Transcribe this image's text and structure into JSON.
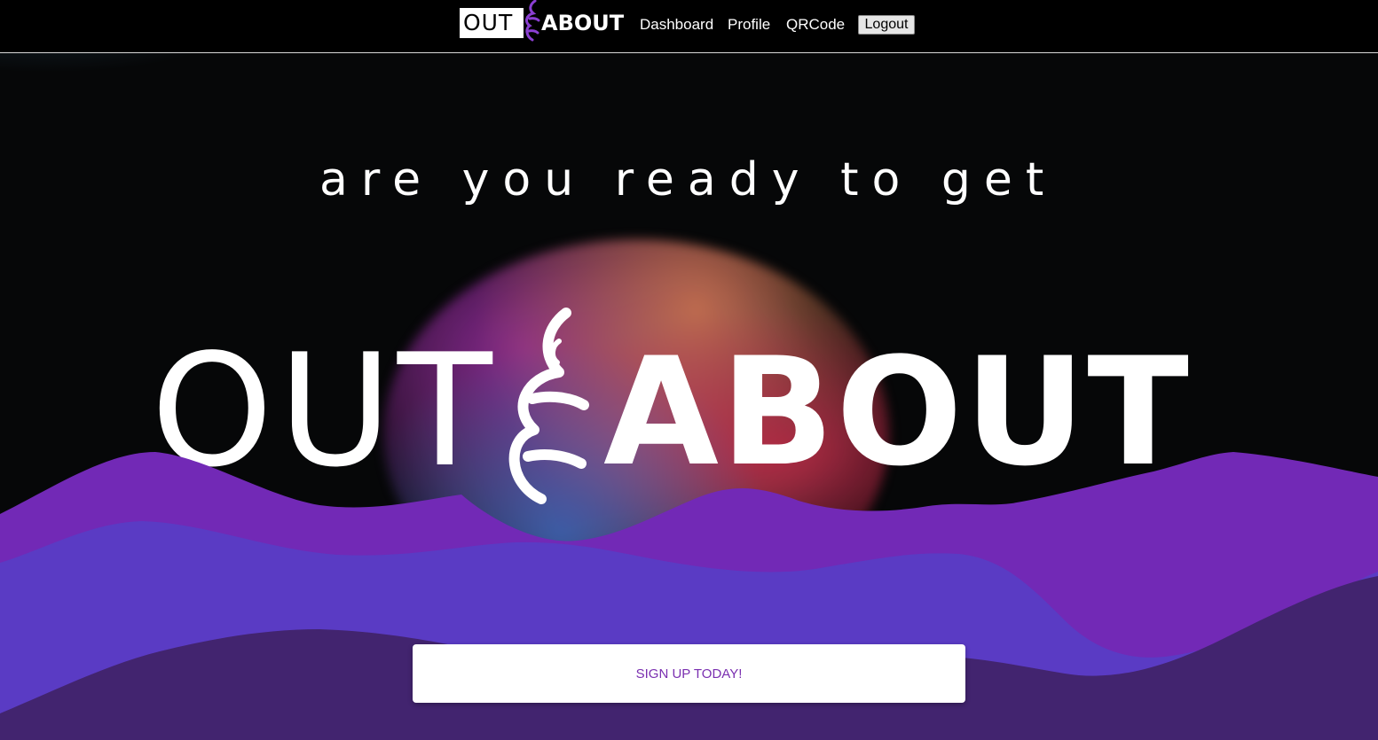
{
  "navbar": {
    "brand": {
      "out": "OUT",
      "about": "ABOUT",
      "accent": "#8a3fd1"
    },
    "links": [
      {
        "label": "Dashboard"
      },
      {
        "label": "Profile"
      },
      {
        "label": "QRCode"
      }
    ],
    "logout_label": "Logout"
  },
  "hero": {
    "tagline": "are you ready to get",
    "logo": {
      "out": "OUT",
      "about": "ABOUT"
    },
    "cta_label": "SIGN UP TODAY!",
    "colors": {
      "background": "#060708",
      "mountain_front": "#7229b6",
      "mountain_middle": "#5a3bc4",
      "mountain_back": "#42246f",
      "cta_text": "#7a2fb0"
    }
  }
}
